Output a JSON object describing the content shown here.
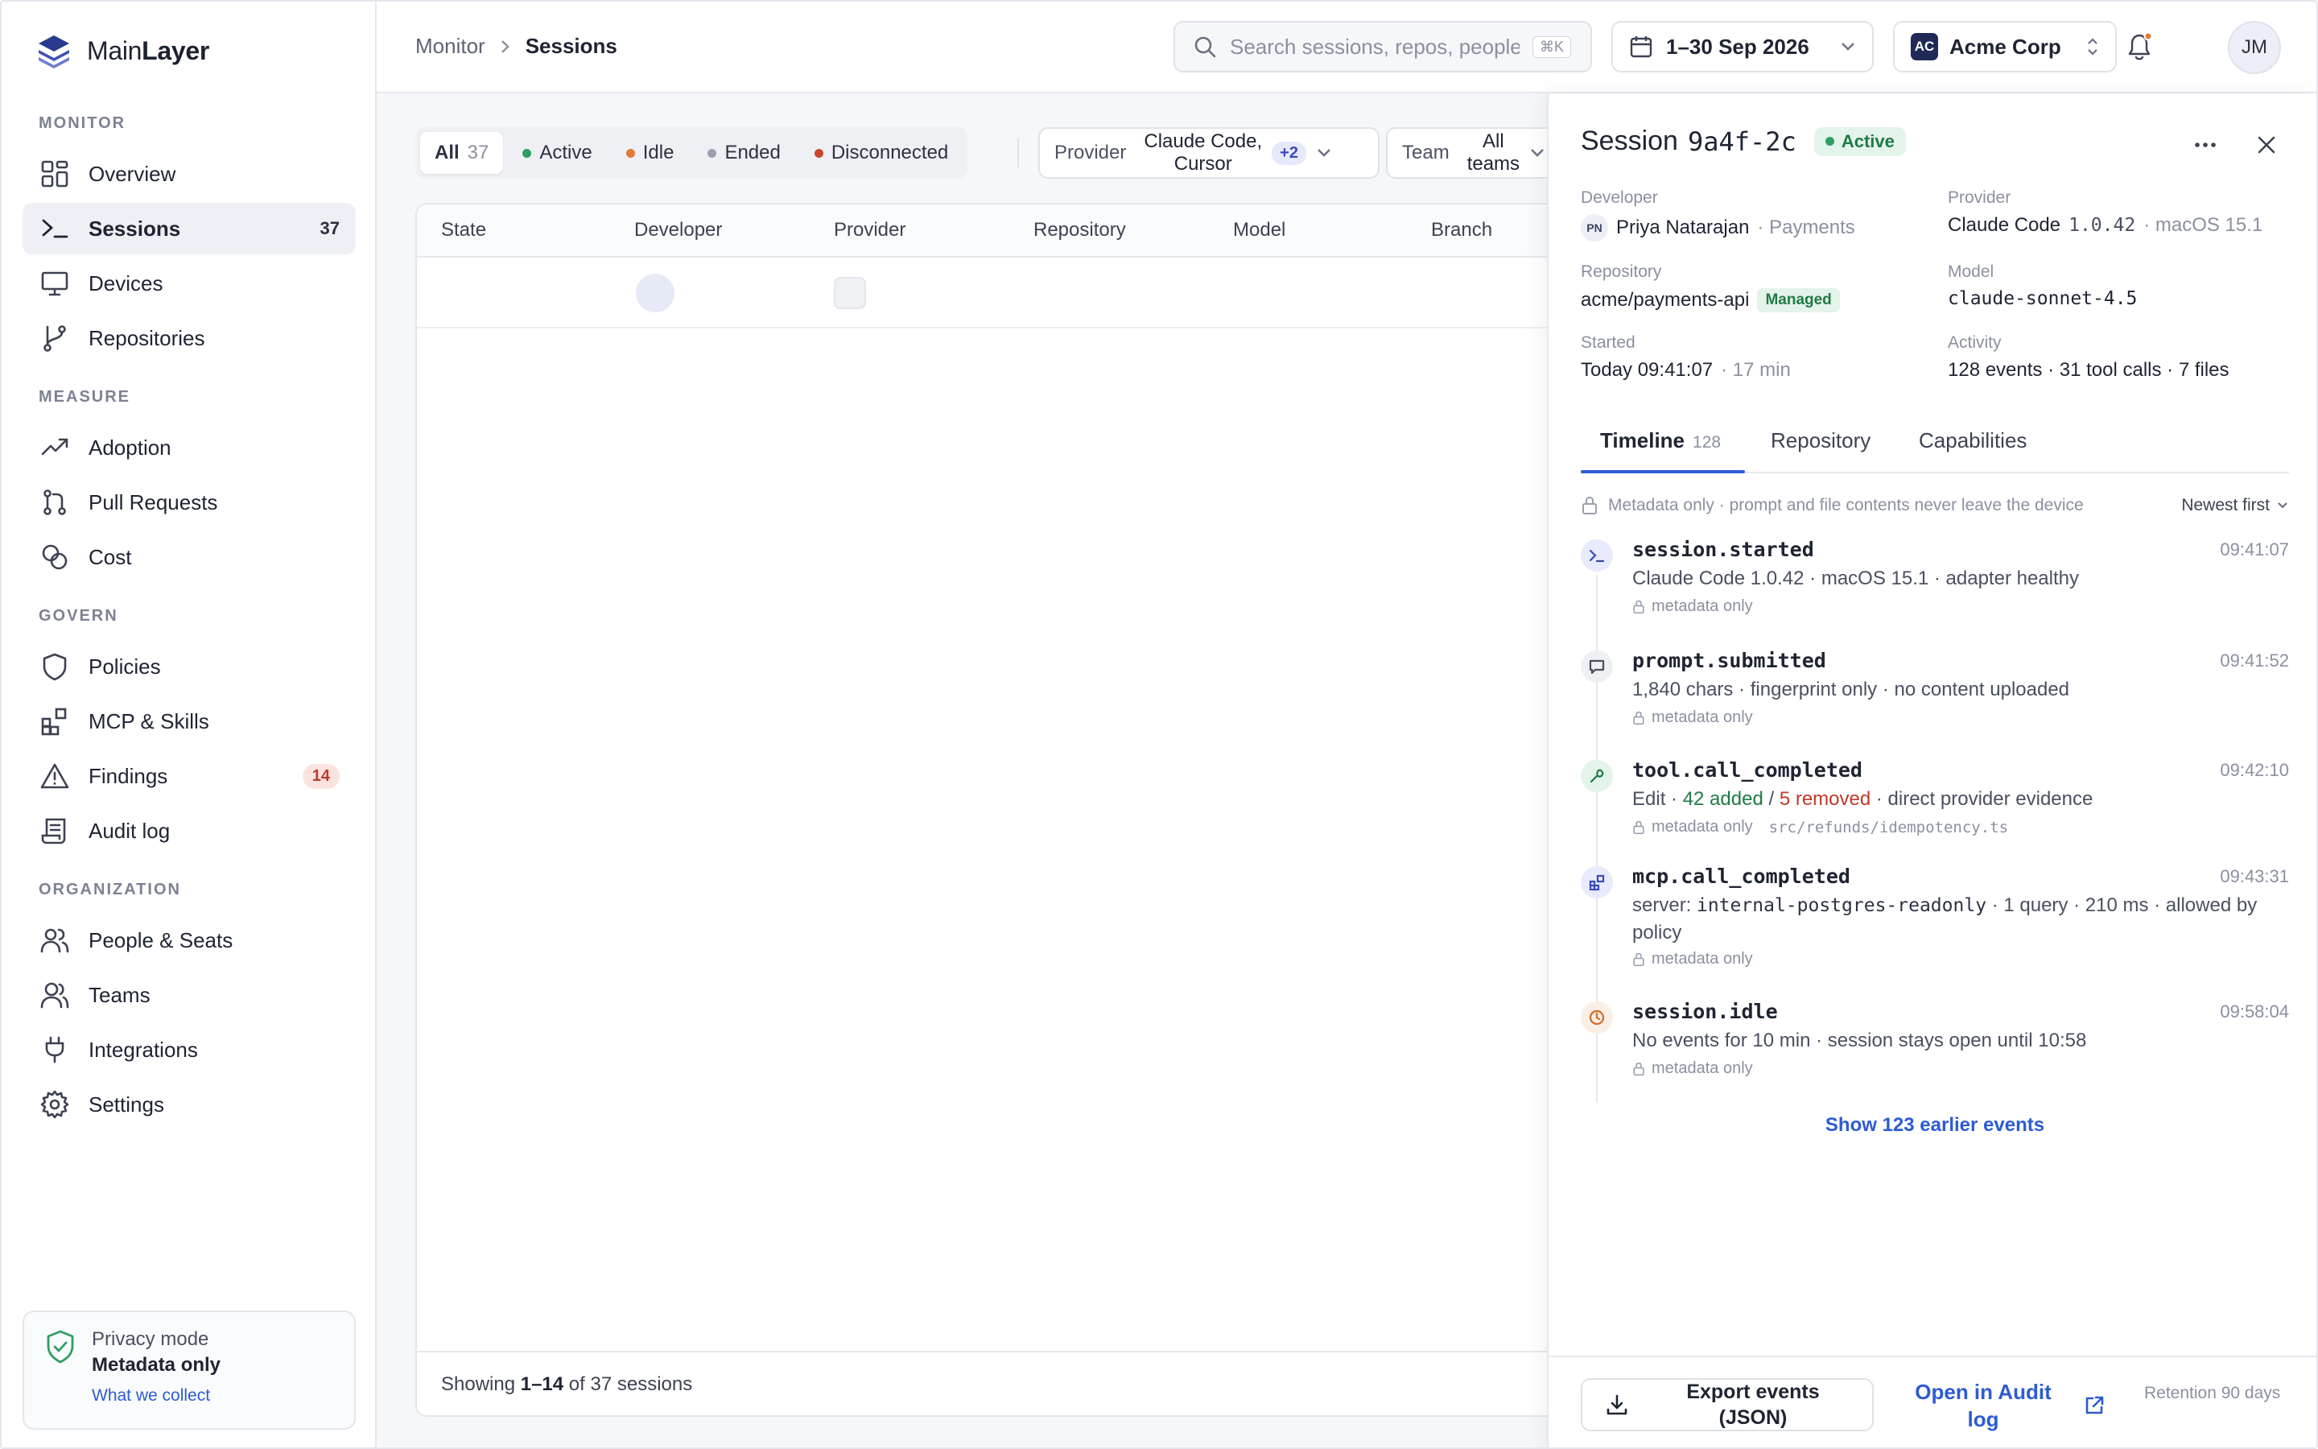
{
  "brand": {
    "name_a": "Main",
    "name_b": "Layer"
  },
  "sidebar": {
    "sections": {
      "monitor": "MONITOR",
      "measure": "MEASURE",
      "govern": "GOVERN",
      "organization": "ORGANIZATION"
    },
    "items": [
      {
        "label": "Overview",
        "icon": "grid-icon"
      },
      {
        "label": "Sessions",
        "icon": "terminal-icon",
        "count": "37",
        "active": true
      },
      {
        "label": "Devices",
        "icon": "monitor-icon"
      },
      {
        "label": "Repositories",
        "icon": "git-branch-icon"
      },
      {
        "label": "Adoption",
        "icon": "trend-icon"
      },
      {
        "label": "Pull Requests",
        "icon": "pull-request-icon"
      },
      {
        "label": "Cost",
        "icon": "coins-icon"
      },
      {
        "label": "Policies",
        "icon": "shield-icon"
      },
      {
        "label": "MCP & Skills",
        "icon": "blocks-icon"
      },
      {
        "label": "Findings",
        "icon": "warning-icon",
        "badge": "14"
      },
      {
        "label": "Audit log",
        "icon": "scroll-icon"
      },
      {
        "label": "People & Seats",
        "icon": "users-icon"
      },
      {
        "label": "Teams",
        "icon": "team-icon"
      },
      {
        "label": "Integrations",
        "icon": "plug-icon"
      },
      {
        "label": "Settings",
        "icon": "gear-icon"
      }
    ],
    "privacy": {
      "title": "Privacy mode",
      "value": "Metadata only",
      "link": "What we collect"
    }
  },
  "topbar": {
    "breadcrumb": {
      "parent": "Monitor",
      "current": "Sessions"
    },
    "search_placeholder": "Search sessions, repos, people…",
    "search_shortcut": "⌘K",
    "date_range": "1–30 Sep 2026",
    "org": {
      "initials": "AC",
      "name": "Acme Corp"
    },
    "user_initials": "JM"
  },
  "filters": {
    "segments": [
      {
        "label": "All",
        "count": "37"
      },
      {
        "label": "Active",
        "color": "#2e9e63"
      },
      {
        "label": "Idle",
        "color": "#e07b39"
      },
      {
        "label": "Ended",
        "color": "#9aa0ad"
      },
      {
        "label": "Disconnected",
        "color": "#c8462b"
      }
    ],
    "provider": {
      "label": "Provider",
      "value_line1": "Claude Code,",
      "value_line2": "Cursor",
      "more": "+2"
    },
    "team": {
      "label": "Team",
      "value_line1": "All",
      "value_line2": "teams"
    }
  },
  "table": {
    "columns": [
      "State",
      "Developer",
      "Provider",
      "Repository",
      "Model",
      "Branch"
    ],
    "footer": {
      "prefix": "Showing ",
      "range": "1–14",
      "suffix": " of 37 sessions"
    }
  },
  "drawer": {
    "title_prefix": "Session",
    "session_id": "9a4f-2c",
    "status": "Active",
    "fields": {
      "developer_label": "Developer",
      "developer_initials": "PN",
      "developer_name": "Priya Natarajan",
      "developer_team": "· Payments",
      "provider_label": "Provider",
      "provider_name": "Claude Code",
      "provider_version": "1.0.42",
      "provider_os": "· macOS 15.1",
      "repository_label": "Repository",
      "repository_value": "acme/payments-api",
      "repository_badge": "Managed",
      "model_label": "Model",
      "model_value": "claude-sonnet-4.5",
      "started_label": "Started",
      "started_value": "Today 09:41:07",
      "started_duration": "· 17 min",
      "activity_label": "Activity",
      "activity_value": "128 events · 31 tool calls · 7 files"
    },
    "tabs": [
      {
        "label": "Timeline",
        "count": "128"
      },
      {
        "label": "Repository"
      },
      {
        "label": "Capabilities"
      }
    ],
    "note": "Metadata only · prompt and file contents never leave the device",
    "sort": "Newest first",
    "events": [
      {
        "name": "session.started",
        "time": "09:41:07",
        "desc": "Claude Code 1.0.42 · macOS 15.1 · adapter healthy",
        "meta": "metadata only"
      },
      {
        "name": "prompt.submitted",
        "time": "09:41:52",
        "desc": "1,840 chars · fingerprint only · no content uploaded",
        "meta": "metadata only"
      },
      {
        "name": "tool.call_completed",
        "time": "09:42:10",
        "desc_prefix": "Edit · ",
        "added": "42 added",
        "sep": " / ",
        "removed": "5 removed",
        "desc_suffix": " · direct provider evidence",
        "meta": "metadata only",
        "file": "src/refunds/idempotency.ts"
      },
      {
        "name": "mcp.call_completed",
        "time": "09:43:31",
        "desc_prefix": "server: ",
        "server": "internal-postgres-readonly",
        "desc_suffix": " · 1 query · 210 ms · allowed by policy",
        "meta": "metadata only"
      },
      {
        "name": "session.idle",
        "time": "09:58:04",
        "desc": "No events for 10 min · session stays open until 10:58",
        "meta": "metadata only"
      }
    ],
    "show_more": "Show 123 earlier events",
    "footer": {
      "export_line1": "Export events",
      "export_line2": "(JSON)",
      "audit_line1": "Open in Audit",
      "audit_line2": "log",
      "retention": "Retention 90 days"
    }
  }
}
